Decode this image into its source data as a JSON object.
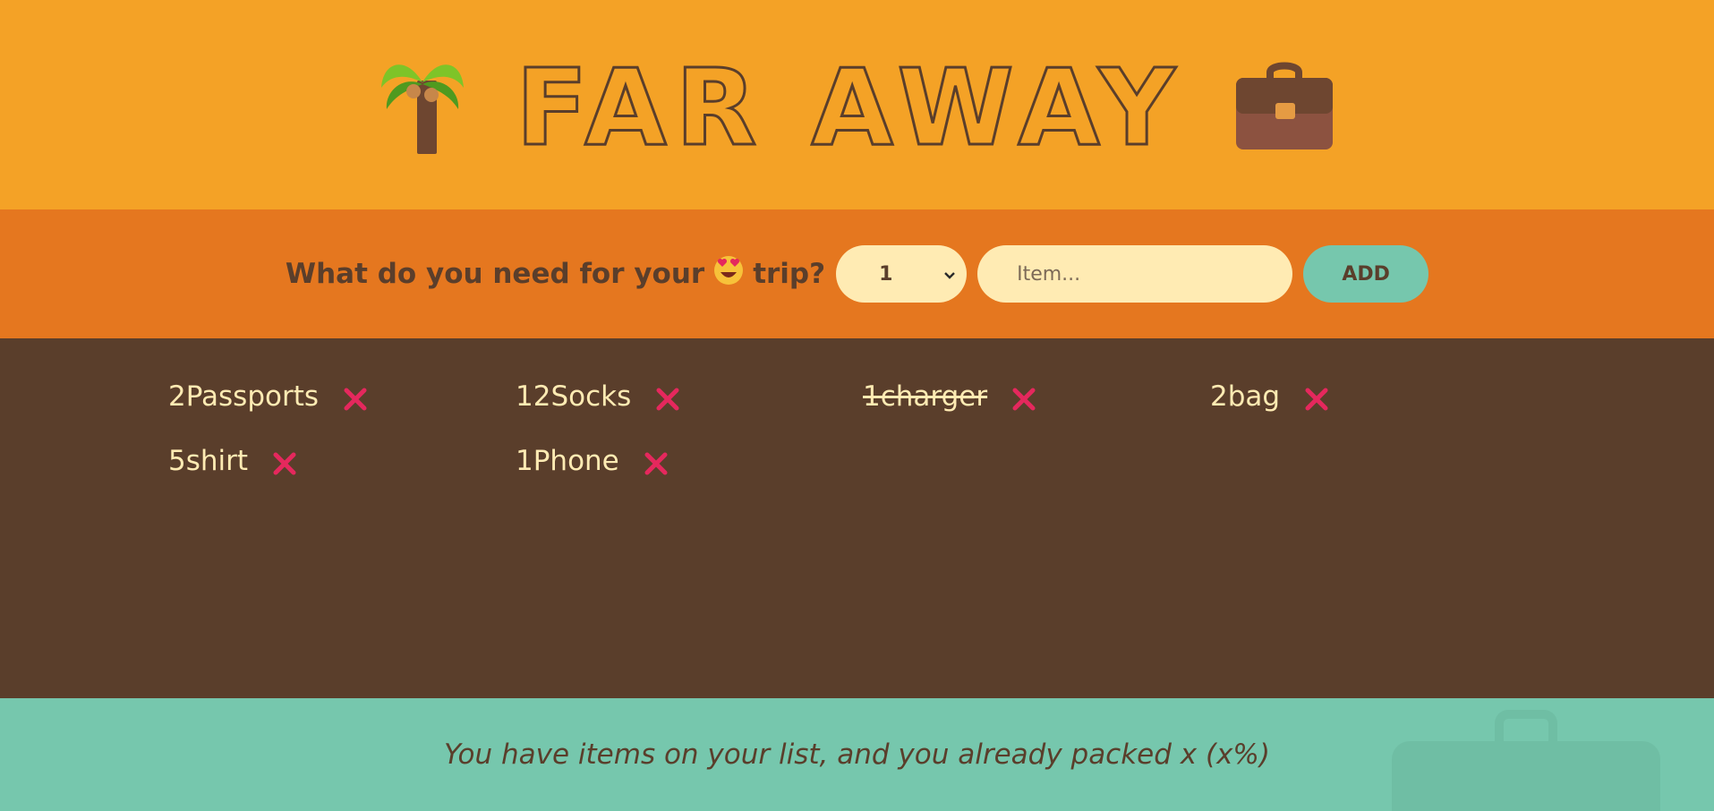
{
  "colors": {
    "header_bg": "#f4a226",
    "form_bg": "#e5771f",
    "list_bg": "#5a3e2b",
    "stats_bg": "#76c7ad",
    "cream": "#ffebb3",
    "brown": "#5a3e2b",
    "remove_red": "#e5285d"
  },
  "header": {
    "title": "FAR AWAY",
    "left_icon": "palm-tree-icon",
    "right_icon": "briefcase-icon"
  },
  "form": {
    "question_before": "What do you need for your",
    "question_emoji": "smiling-face-with-heart-eyes-icon",
    "question_after": "trip?",
    "quantity_value": "1",
    "item_placeholder": "Item...",
    "add_label": "ADD"
  },
  "items": [
    {
      "text": "2Passports",
      "packed": false
    },
    {
      "text": "12Socks",
      "packed": false
    },
    {
      "text": "1charger",
      "packed": true
    },
    {
      "text": "2bag",
      "packed": false
    },
    {
      "text": "5shirt",
      "packed": false
    },
    {
      "text": "1Phone",
      "packed": false
    }
  ],
  "remove_icon": "close-icon",
  "stats": {
    "text": "You have items on your list, and you already packed x (x%)"
  }
}
